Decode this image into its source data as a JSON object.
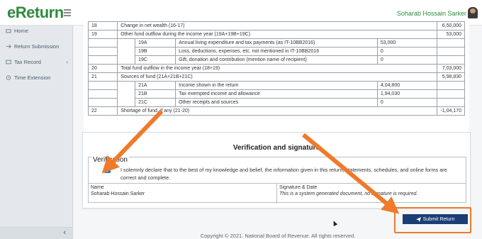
{
  "header": {
    "logo_e": "e",
    "logo_rest": "Return",
    "user_name": "Soharab Hossain Sarker"
  },
  "sidebar": {
    "items": [
      {
        "label": "Home",
        "icon": "home-icon"
      },
      {
        "label": "Return Submission",
        "icon": "return-icon"
      },
      {
        "label": "Tax Record",
        "icon": "tax-record-icon",
        "chevron": "‹"
      },
      {
        "label": "Time Extension",
        "icon": "clock-icon"
      }
    ],
    "collapse_label": "‹"
  },
  "fund_table": {
    "rows": [
      {
        "no": "18",
        "desc": "Change in net wealth (16-17)",
        "sub": "",
        "subdesc": "",
        "subval": "",
        "val": "6,50,000"
      },
      {
        "no": "19",
        "desc": "Other fund outflow during the income year (19A+19B+19C)",
        "sub": "",
        "subdesc": "",
        "subval": "",
        "val": "53,000"
      },
      {
        "no": "",
        "desc": "",
        "sub": "19A",
        "subdesc": "Annual living expenditure and tax payments (as IT-10BB2016)",
        "subval": "53,000",
        "val": ""
      },
      {
        "no": "",
        "desc": "",
        "sub": "19B",
        "subdesc": "Loss, deductions, expenses, etc. not mentioned in IT-10BB2016",
        "subval": "0",
        "val": ""
      },
      {
        "no": "",
        "desc": "",
        "sub": "19C",
        "subdesc": "Gift, donation and contribution (mention name of recipient)",
        "subval": "0",
        "val": ""
      },
      {
        "no": "20",
        "desc": "Total fund outflow in the income year (18+19)",
        "sub": "",
        "subdesc": "",
        "subval": "",
        "val": "7,03,000"
      },
      {
        "no": "21",
        "desc": "Sources of fund (21A+21B+21C)",
        "sub": "",
        "subdesc": "",
        "subval": "",
        "val": "5,98,830"
      },
      {
        "no": "",
        "desc": "",
        "sub": "21A",
        "subdesc": "Income shown in the return",
        "subval": "4,04,800",
        "val": ""
      },
      {
        "no": "",
        "desc": "",
        "sub": "21B",
        "subdesc": "Tax exempted income and allowance",
        "subval": "1,94,030",
        "val": ""
      },
      {
        "no": "",
        "desc": "",
        "sub": "21C",
        "subdesc": "Other receipts and sources",
        "subval": "0",
        "val": ""
      },
      {
        "no": "22",
        "desc": "Shortage of fund, if any (21-20)",
        "sub": "",
        "subdesc": "",
        "subval": "",
        "val": "-1,04,170"
      }
    ]
  },
  "verification": {
    "title": "Verification and signature",
    "legend": "Verification",
    "checked": true,
    "declaration": "I solemnly declare that to the best of my knowledge and belief, the information given in this return, statements, schedules, and online forms are correct and complete.",
    "name_label": "Name",
    "name_value": "Soharab Hossain Sarker",
    "sign_label": "Signature & Date",
    "sign_value": "This is a system generated document, no signature is required."
  },
  "actions": {
    "submit_label": "Submit Return",
    "submit_icon": "paper-plane-icon"
  },
  "footer": {
    "copyright": "Copyright © 2021. National Board of Revenue. All rights reserved."
  },
  "colors": {
    "brand_green": "#2e8b3e",
    "submit_blue": "#1b3e75",
    "annotation_orange": "#ef7a2a",
    "checkbox_blue": "#1976d2"
  }
}
